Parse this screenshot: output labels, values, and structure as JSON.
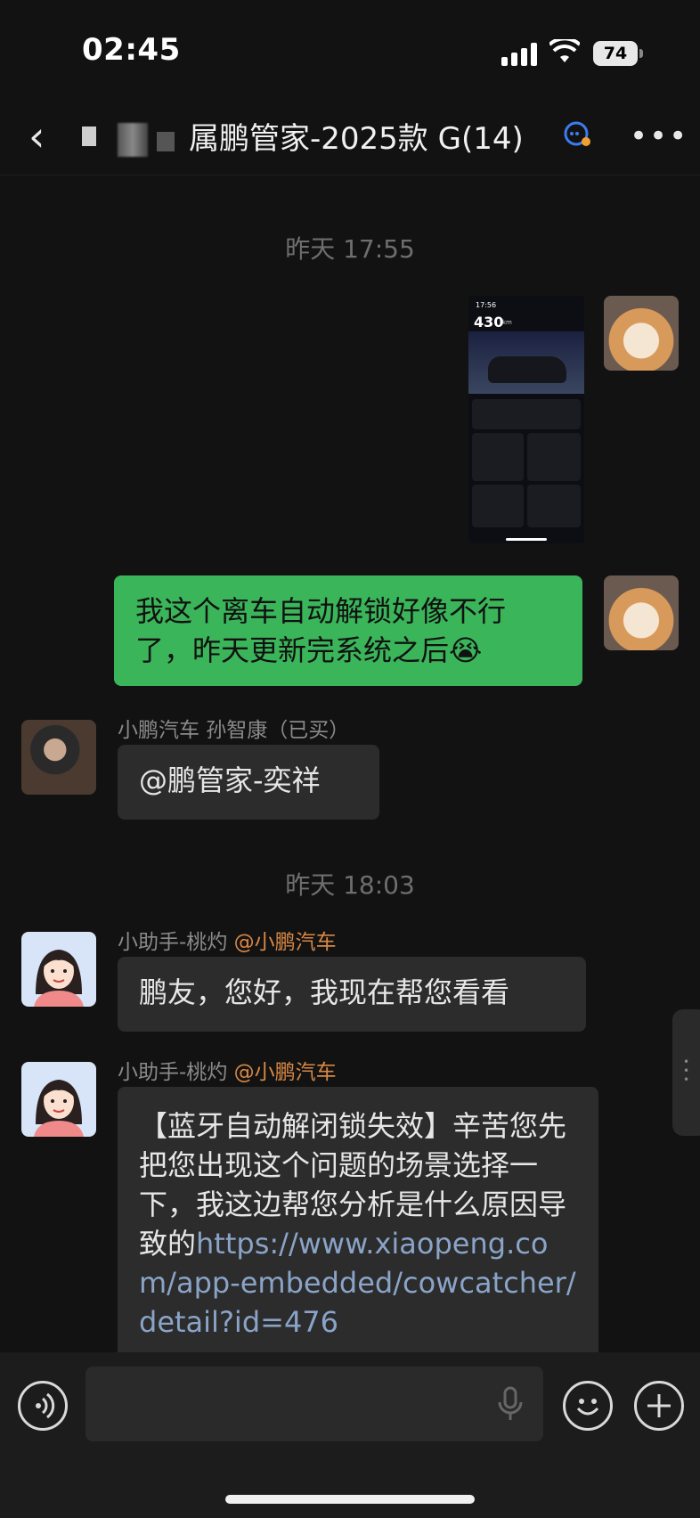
{
  "status": {
    "time": "02:45",
    "battery": "74"
  },
  "header": {
    "title": "属鹏管家-2025款 G",
    "count": "(14)"
  },
  "messages": {
    "ts1": "昨天 17:55",
    "shot": {
      "time": "17:56",
      "range": "430",
      "range_unit": "km"
    },
    "m2": "我这个离车自动解锁好像不行了，昨天更新完系统之后😭",
    "m3_name": "小鹏汽车 孙智康（已买）",
    "m3": "@鹏管家-奕祥",
    "ts2": "昨天 18:03",
    "m4_name": "小助手-桃灼",
    "m4_tag": "@小鹏汽车",
    "m4": "鹏友，您好，我现在帮您看看",
    "m5_name": "小助手-桃灼",
    "m5_tag": "@小鹏汽车",
    "m5_text": "【蓝牙自动解闭锁失效】辛苦您先把您出现这个问题的场景选择一下，我这边帮您分析是什么原因导致的",
    "m5_link": "https://www.xiaopeng.com/app-embedded/cowcatcher/detail?id=476"
  },
  "icons": [
    "back-icon",
    "more-icon",
    "voice-icon",
    "mic-icon",
    "emoji-icon",
    "add-icon"
  ]
}
